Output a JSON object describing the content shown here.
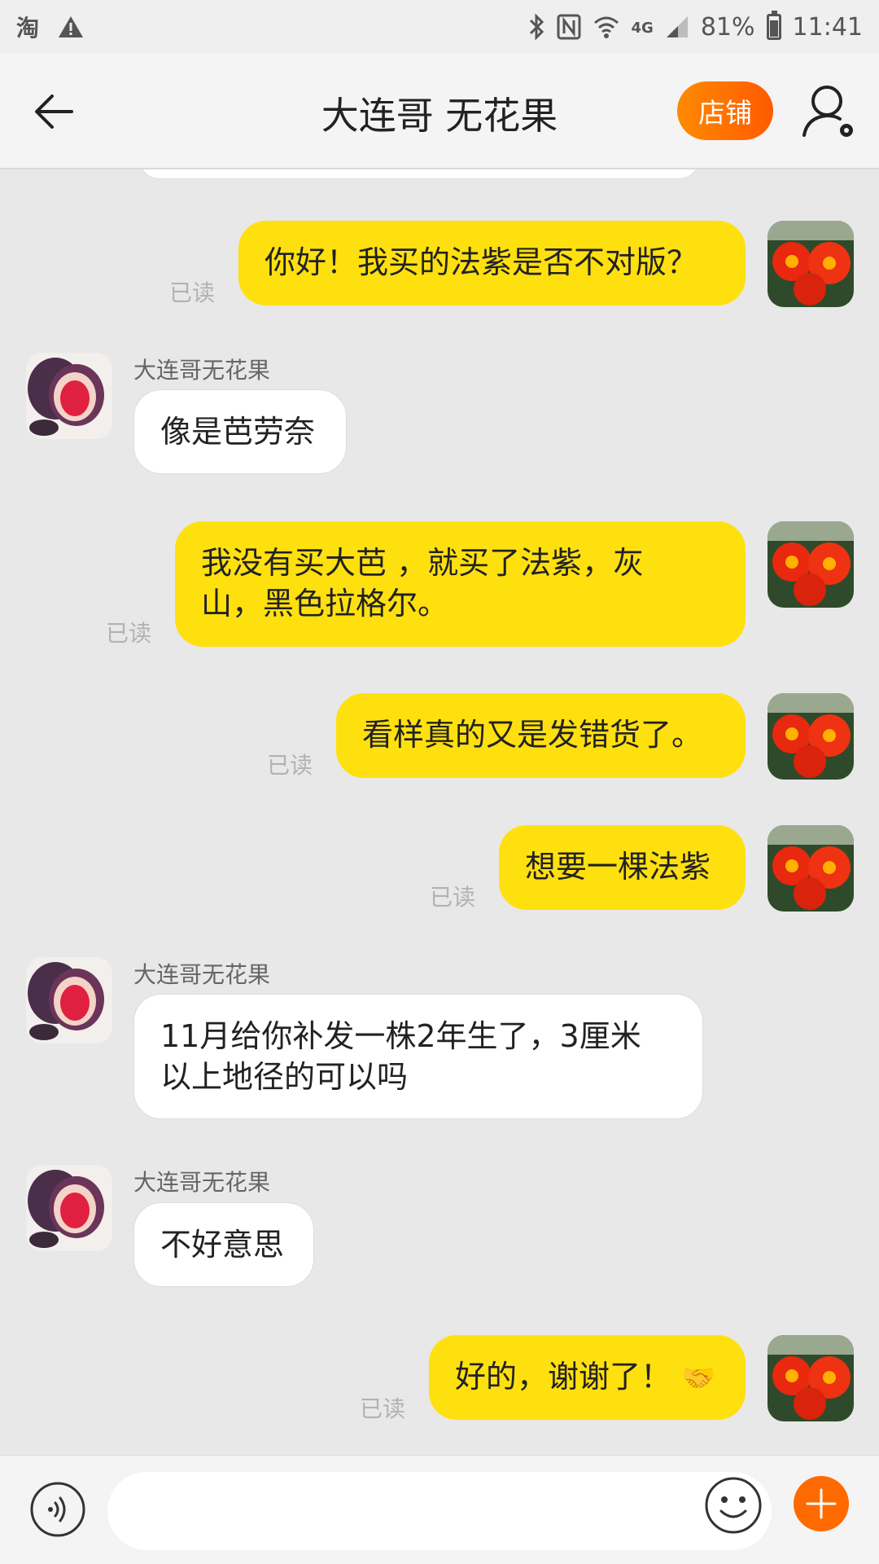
{
  "status_bar": {
    "app_glyph": "淘",
    "battery": "81%",
    "network": "4G",
    "time": "11:41"
  },
  "header": {
    "title": "大连哥 无花果",
    "shop_button": "店铺"
  },
  "chat": {
    "read_label": "已读",
    "messages": [
      {
        "from": "me",
        "text": "你好！我买的法紫是否不对版？",
        "read": "已读"
      },
      {
        "from": "them",
        "sender": "大连哥无花果",
        "text": "像是芭劳奈"
      },
      {
        "from": "me",
        "line1": "我没有买大芭 ，就买了法紫，灰",
        "line2": "山，黑色拉格尔。",
        "read": "已读"
      },
      {
        "from": "me",
        "text": "看样真的又是发错货了。",
        "read": "已读"
      },
      {
        "from": "me",
        "text": "想要一棵法紫",
        "read": "已读"
      },
      {
        "from": "them",
        "sender": "大连哥无花果",
        "line1": "11月给你补发一株2年生了，3厘米",
        "line2": "以上地径的可以吗"
      },
      {
        "from": "them",
        "sender": "大连哥无花果",
        "text": "不好意思"
      },
      {
        "from": "me",
        "text": "好的，谢谢了！",
        "emoji": "🤝",
        "read": "已读"
      }
    ]
  },
  "icons": {
    "back": "back-arrow-icon",
    "profile": "user-settings-icon",
    "voice": "voice-icon",
    "emoji": "emoji-icon",
    "plus": "plus-icon"
  },
  "colors": {
    "my_bubble": "#ffe00f",
    "their_bubble": "#ffffff",
    "accent": "#ff6a00",
    "background": "#e8e8e8"
  }
}
